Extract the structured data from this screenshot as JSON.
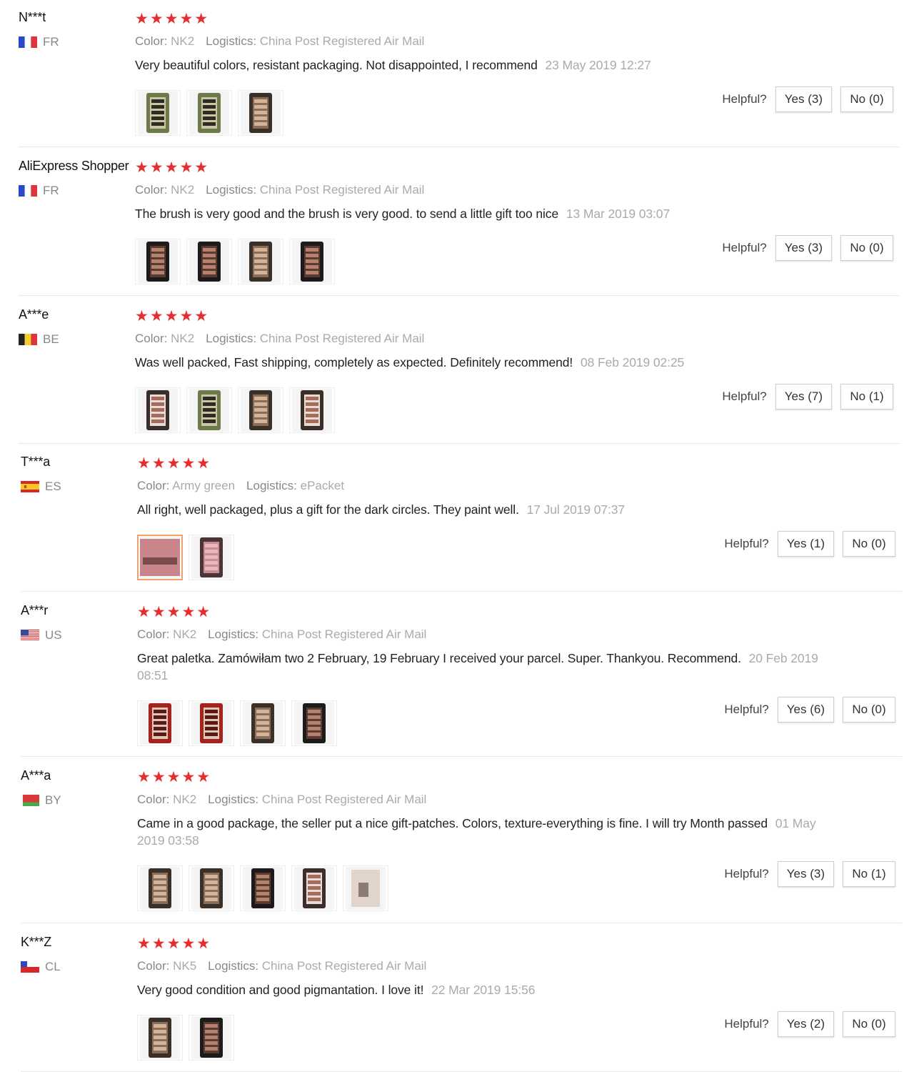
{
  "colors": {
    "star": "#e62e2e",
    "muted": "#aaaaaa",
    "divider": "#e8e8e8"
  },
  "labels": {
    "color": "Color:",
    "logistics": "Logistics:",
    "helpful": "Helpful?"
  },
  "reviews": [
    {
      "user": "N***t",
      "country": "FR",
      "flag": "fr",
      "stars": "★★★★★",
      "color": "NK2",
      "logistics": "China Post Registered Air Mail",
      "text": "Very beautiful colors, resistant packaging. Not disappointed, I recommend",
      "date": "23 May 2019 12:27",
      "photos": [
        "photo-palette-green",
        "photo-palette-green",
        "photo-palette-open"
      ],
      "yes": "Yes (3)",
      "no": "No (0)"
    },
    {
      "user": "AliExpress Shopper",
      "country": "FR",
      "flag": "fr",
      "stars": "★★★★★",
      "color": "NK2",
      "logistics": "China Post Registered Air Mail",
      "text": "The brush is very good and the brush is very good. to send a little gift too nice",
      "date": "13 Mar 2019 03:07",
      "photos": [
        "photo-box-dark",
        "photo-box-dark",
        "photo-palette-open",
        "photo-box-dark"
      ],
      "yes": "Yes (3)",
      "no": "No (0)"
    },
    {
      "user": "A***e",
      "country": "BE",
      "flag": "be",
      "stars": "★★★★★",
      "color": "NK2",
      "logistics": "China Post Registered Air Mail",
      "text": "Was well packed, Fast shipping, completely as expected. Definitely recommend!",
      "date": "08 Feb 2019 02:25",
      "photos": [
        "photo-box-light",
        "photo-palette-green",
        "photo-palette-open",
        "photo-box-light"
      ],
      "yes": "Yes (7)",
      "no": "No (1)"
    },
    {
      "user": "T***a",
      "country": "ES",
      "flag": "es",
      "stars": "★★★★★",
      "color": "Army green",
      "logistics": "ePacket",
      "text": "All right, well packaged, plus a gift for the dark circles. They paint well.",
      "date": "17 Jul 2019 07:37",
      "photos": [
        "photo-pink",
        "photo-pink-open"
      ],
      "yes": "Yes (1)",
      "no": "No (0)"
    },
    {
      "user": "A***r",
      "country": "US",
      "flag": "us",
      "stars": "★★★★★",
      "color": "NK2",
      "logistics": "China Post Registered Air Mail",
      "text": "Great paletka. Zamówiłam two 2 February, 19 February I received your parcel. Super. Thankyou. Recommend.",
      "date": "20 Feb 2019 08:51",
      "photos": [
        "photo-box-red",
        "photo-box-red",
        "photo-palette-open",
        "photo-box-dark"
      ],
      "yes": "Yes (6)",
      "no": "No (0)"
    },
    {
      "user": "A***a",
      "country": "BY",
      "flag": "by",
      "stars": "★★★★★",
      "color": "NK2",
      "logistics": "China Post Registered Air Mail",
      "text": "Came in a good package, the seller put a nice gift-patches. Colors, texture-everything is fine. I will try Month passed",
      "date": "01 May 2019 03:58",
      "photos": [
        "photo-palette-open",
        "photo-palette-open",
        "photo-box-dark",
        "photo-box-light",
        "photo-skin"
      ],
      "yes": "Yes (3)",
      "no": "No (1)"
    },
    {
      "user": "K***Z",
      "country": "CL",
      "flag": "cl",
      "stars": "★★★★★",
      "color": "NK5",
      "logistics": "China Post Registered Air Mail",
      "text": "Very good condition and good pigmantation. I love it!",
      "date": "22 Mar 2019 15:56",
      "photos": [
        "photo-palette-open",
        "photo-box-dark"
      ],
      "yes": "Yes (2)",
      "no": "No (0)"
    }
  ]
}
